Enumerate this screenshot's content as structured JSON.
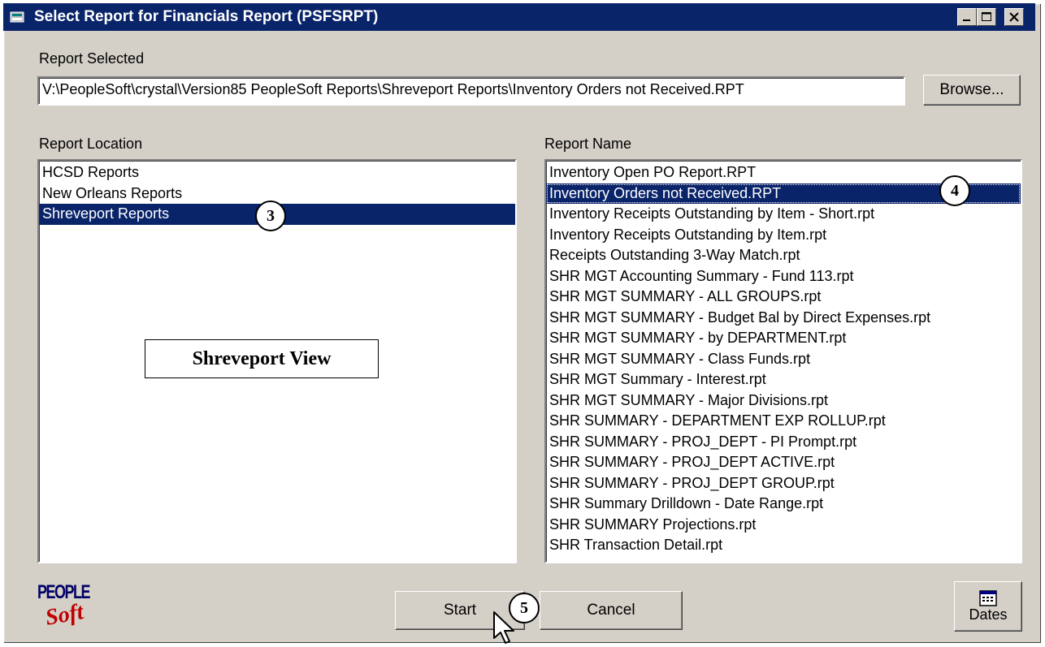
{
  "window": {
    "title": "Select Report for Financials Report (PSFSRPT)",
    "minimize_label": "_",
    "maximize_label": "□",
    "close_label": "×"
  },
  "report_selected": {
    "label": "Report Selected",
    "value": "V:\\PeopleSoft\\crystal\\Version85 PeopleSoft Reports\\Shreveport Reports\\Inventory Orders not Received.RPT",
    "browse_label": "Browse..."
  },
  "report_location": {
    "label": "Report Location",
    "items": [
      "HCSD Reports",
      "New Orleans Reports",
      "Shreveport Reports"
    ],
    "selected_index": 2
  },
  "report_name": {
    "label": "Report Name",
    "items": [
      "Inventory Open PO Report.RPT",
      "Inventory Orders not Received.RPT",
      "Inventory Receipts Outstanding by Item - Short.rpt",
      "Inventory Receipts Outstanding by Item.rpt",
      "Receipts Outstanding 3-Way Match.rpt",
      "SHR MGT Accounting Summary - Fund 113.rpt",
      "SHR MGT SUMMARY - ALL GROUPS.rpt",
      "SHR MGT SUMMARY - Budget Bal by Direct Expenses.rpt",
      "SHR MGT SUMMARY - by DEPARTMENT.rpt",
      "SHR MGT SUMMARY - Class Funds.rpt",
      "SHR MGT Summary - Interest.rpt",
      "SHR MGT SUMMARY - Major Divisions.rpt",
      "SHR SUMMARY - DEPARTMENT EXP ROLLUP.rpt",
      "SHR SUMMARY - PROJ_DEPT - PI Prompt.rpt",
      "SHR SUMMARY - PROJ_DEPT ACTIVE.rpt",
      "SHR SUMMARY - PROJ_DEPT GROUP.rpt",
      "SHR Summary Drilldown - Date Range.rpt",
      "SHR SUMMARY Projections.rpt",
      "SHR Transaction Detail.rpt"
    ],
    "selected_index": 1
  },
  "annotations": {
    "view_label": "Shreveport View",
    "callout_3": "3",
    "callout_4": "4",
    "callout_5": "5"
  },
  "buttons": {
    "start_label": "Start",
    "cancel_label": "Cancel",
    "dates_label": "Dates"
  },
  "logo": {
    "line1": "PEOPLE",
    "line2": "Soft"
  },
  "colors": {
    "titlebar": "#0a246a",
    "selection": "#0a246a",
    "dialog_face": "#d4d0c8",
    "logo_blue": "#000066",
    "logo_red": "#c00000"
  },
  "icons": [
    "window-app-icon",
    "minimize-icon",
    "maximize-icon",
    "close-icon",
    "calendar-icon",
    "mouse-pointer-icon"
  ]
}
